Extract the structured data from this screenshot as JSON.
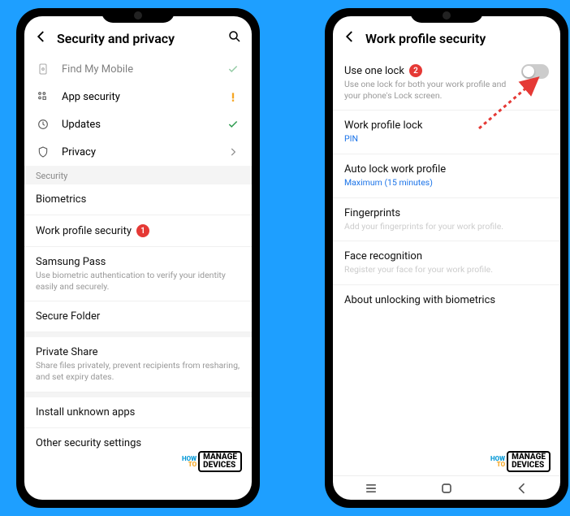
{
  "left": {
    "title": "Security and privacy",
    "rows": [
      {
        "label": "Find My Mobile"
      },
      {
        "label": "App security"
      },
      {
        "label": "Updates"
      },
      {
        "label": "Privacy"
      }
    ],
    "sectionHeader": "Security",
    "items": [
      {
        "title": "Biometrics"
      },
      {
        "title": "Work profile security",
        "badge": "1"
      },
      {
        "title": "Samsung Pass",
        "sub": "Use biometric authentication to verify your identity easily and securely."
      },
      {
        "title": "Secure Folder"
      },
      {
        "title": "Private Share",
        "sub": "Share files privately, prevent recipients from resharing, and set expiry dates."
      },
      {
        "title": "Install unknown apps"
      },
      {
        "title": "Other security settings"
      }
    ]
  },
  "right": {
    "title": "Work profile security",
    "items": [
      {
        "title": "Use one lock",
        "badge": "2",
        "sub": "Use one lock for both your work profile and your phone's Lock screen.",
        "toggle": true
      },
      {
        "title": "Work profile lock",
        "sub": "PIN",
        "subBlue": true
      },
      {
        "title": "Auto lock work profile",
        "sub": "Maximum (15 minutes)",
        "subBlue": true
      },
      {
        "title": "Fingerprints",
        "sub": "Add your fingerprints for your work profile."
      },
      {
        "title": "Face recognition",
        "sub": "Register your face for your work profile."
      },
      {
        "title": "About unlocking with biometrics"
      }
    ]
  },
  "watermark": {
    "line1": "HOW",
    "line2": "TO",
    "box1": "MANAGE",
    "box2": "DEVICES"
  }
}
